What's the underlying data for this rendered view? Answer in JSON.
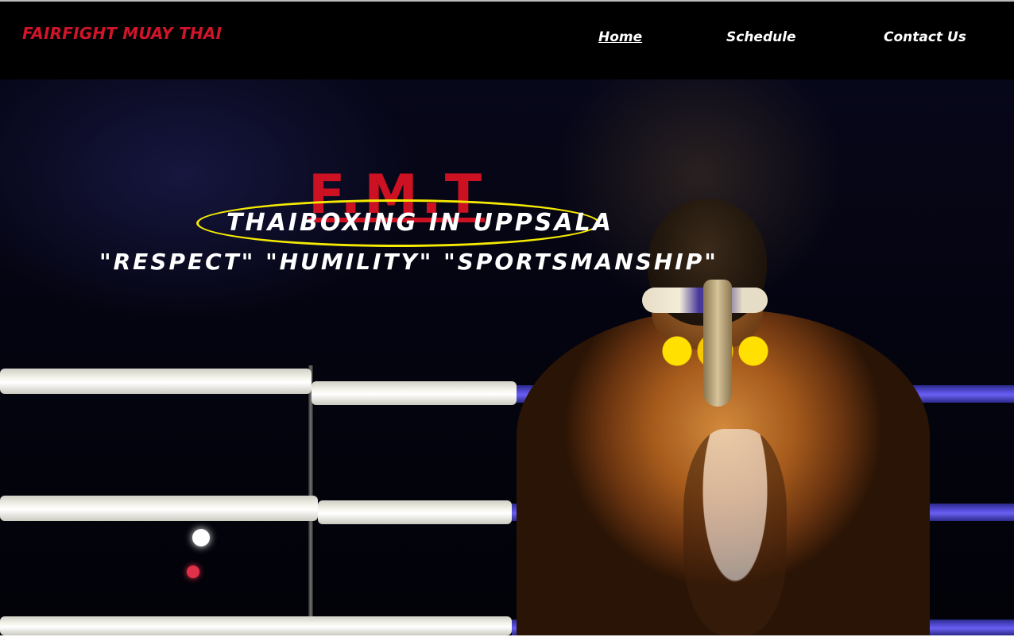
{
  "brand": {
    "name": "FAIRFIGHT MUAY THAI"
  },
  "nav": {
    "items": [
      {
        "label": "Home",
        "active": true
      },
      {
        "label": "Schedule",
        "active": false
      },
      {
        "label": "Contact Us",
        "active": false
      }
    ]
  },
  "hero": {
    "title": "F.M.T",
    "tagline": "THAIBOXING IN UPPSALA",
    "values": "\"RESPECT\" \"HUMILITY\" \"SPORTSMANSHIP\"",
    "image": "muay-thai-fighter-in-ring"
  },
  "colors": {
    "brand_red": "#cc1122",
    "nav_bg": "#000000",
    "highlight_ellipse": "#f5ea00",
    "text": "#ffffff"
  }
}
